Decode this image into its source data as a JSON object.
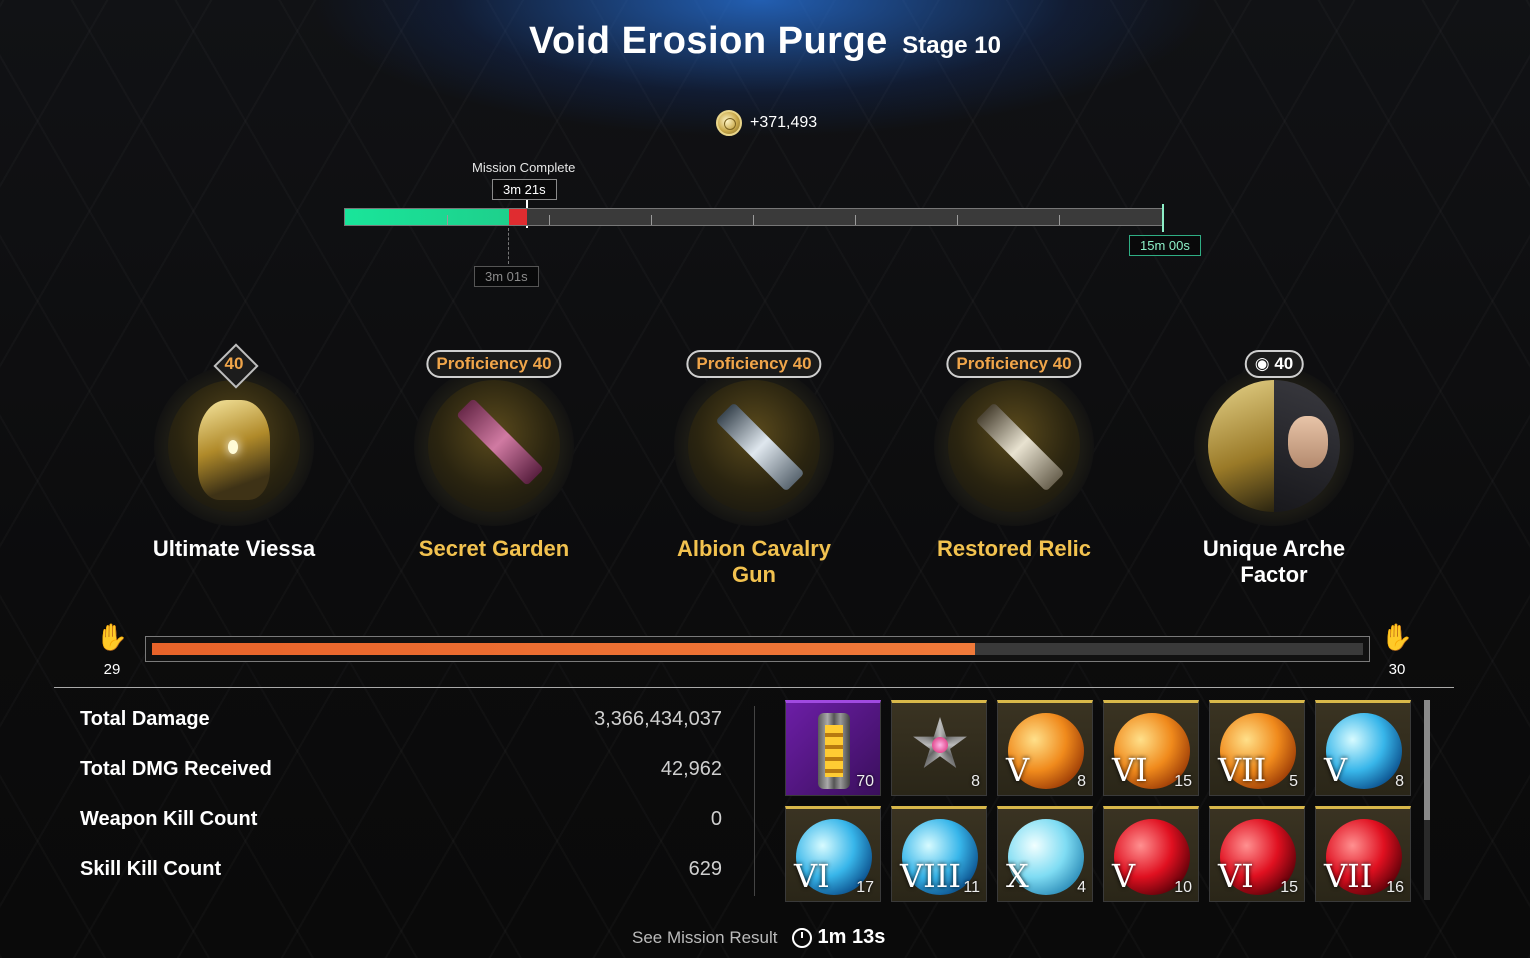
{
  "header": {
    "title": "Void Erosion Purge",
    "stage": "Stage 10",
    "reward": "+371,493",
    "reward_icon": "gold-coin-icon"
  },
  "timeline": {
    "mission_complete_label": "Mission Complete",
    "complete_time": "3m 21s",
    "best_time": "3m 01s",
    "limit_time": "15m 00s",
    "colors": {
      "progress": "#1ed08c",
      "over": "#e02c30"
    }
  },
  "loadout": [
    {
      "name": "Ultimate Viessa",
      "level": "40",
      "kind": "descendant",
      "icon": "descendant-portrait"
    },
    {
      "name": "Secret Garden",
      "badge": "Proficiency 40",
      "kind": "weapon",
      "icon": "weapon-secret-garden"
    },
    {
      "name": "Albion Cavalry Gun",
      "badge": "Proficiency 40",
      "kind": "weapon",
      "icon": "weapon-albion-cavalry-gun"
    },
    {
      "name": "Restored Relic",
      "badge": "Proficiency 40",
      "kind": "weapon",
      "icon": "weapon-restored-relic"
    },
    {
      "name": "Unique Arche Factor",
      "level": "40",
      "kind": "arche",
      "icon": "arche-factor-portrait"
    }
  ],
  "mastery": {
    "current_level": "29",
    "next_level": "30",
    "progress": 0.68,
    "color": "#f07a3a"
  },
  "stats": [
    {
      "label": "Total Damage",
      "value": "3,366,434,037"
    },
    {
      "label": "Total DMG Received",
      "value": "42,962"
    },
    {
      "label": "Weapon Kill Count",
      "value": "0"
    },
    {
      "label": "Skill Kill Count",
      "value": "629"
    }
  ],
  "rewards": [
    {
      "type": "canister",
      "numeral": "",
      "count": "70"
    },
    {
      "type": "star",
      "numeral": "",
      "count": "8"
    },
    {
      "type": "orange",
      "numeral": "V",
      "count": "8"
    },
    {
      "type": "orange",
      "numeral": "VI",
      "count": "15"
    },
    {
      "type": "orange",
      "numeral": "VII",
      "count": "5"
    },
    {
      "type": "blue",
      "numeral": "V",
      "count": "8"
    },
    {
      "type": "blue",
      "numeral": "VI",
      "count": "17"
    },
    {
      "type": "blue",
      "numeral": "VIII",
      "count": "11"
    },
    {
      "type": "lightblue",
      "numeral": "X",
      "count": "4"
    },
    {
      "type": "red",
      "numeral": "V",
      "count": "10"
    },
    {
      "type": "red",
      "numeral": "VI",
      "count": "15"
    },
    {
      "type": "red",
      "numeral": "VII",
      "count": "16"
    }
  ],
  "footer": {
    "see_result": "See Mission Result",
    "timer": "1m 13s"
  }
}
